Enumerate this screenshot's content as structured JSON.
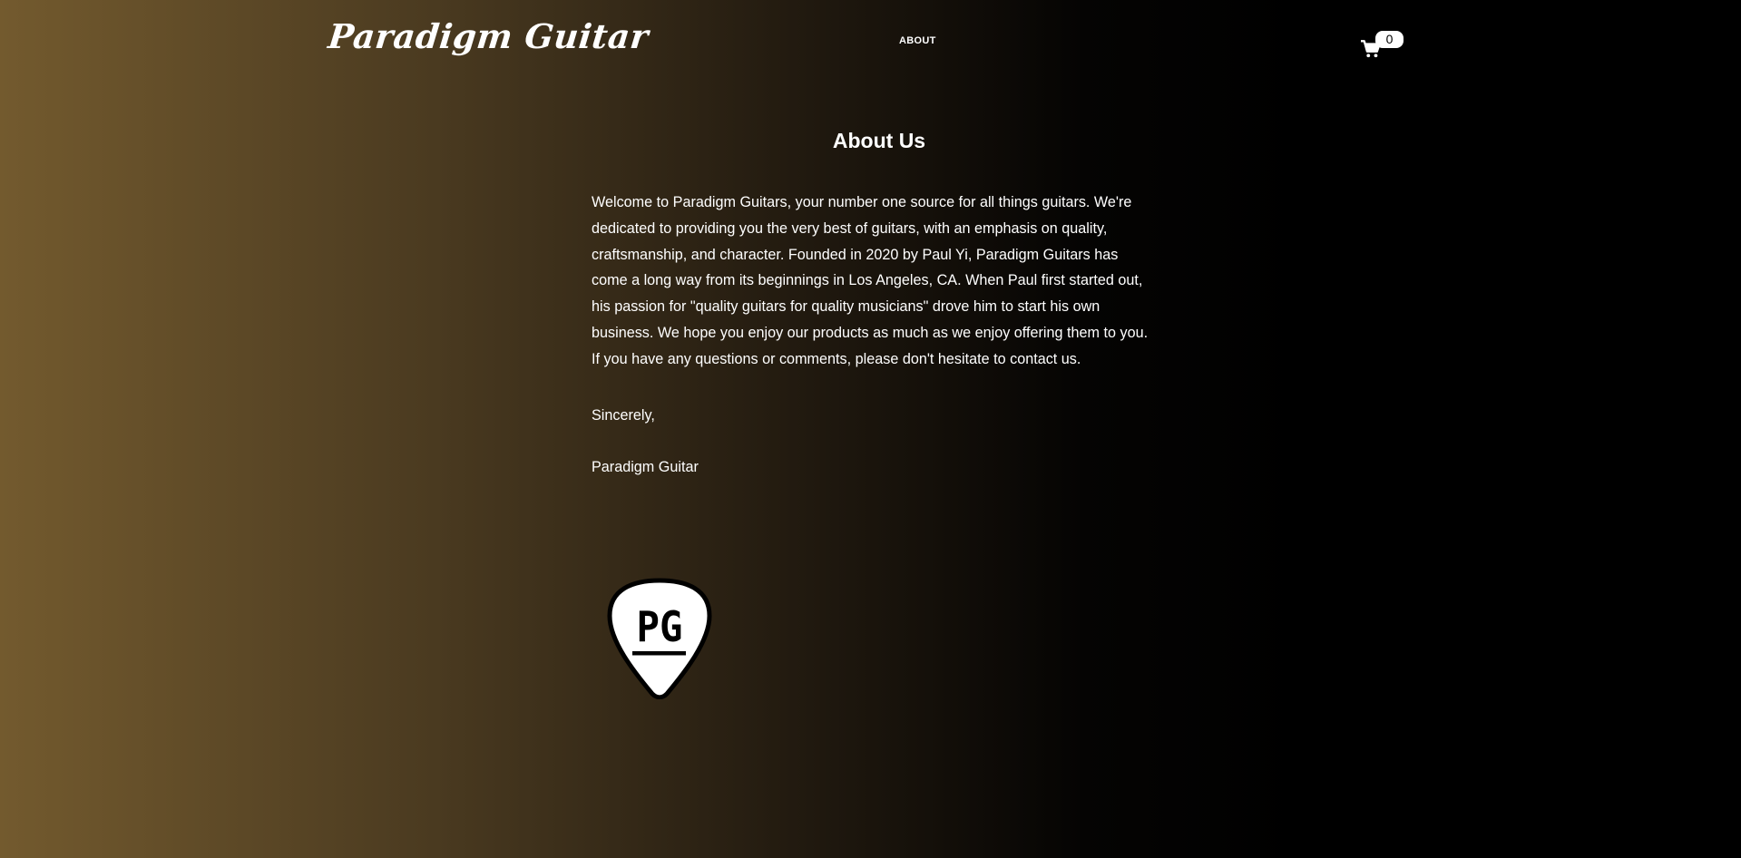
{
  "header": {
    "logo_text": "Paradigm Guitar",
    "nav": {
      "about_label": "ABOUT"
    },
    "cart": {
      "icon": "shopping-cart-icon",
      "count": "0"
    }
  },
  "main": {
    "title": "About Us",
    "intro": "Welcome to Paradigm Guitars, your number one source for all things guitars. We're dedicated to providing you the very best of guitars, with an emphasis on quality, craftsmanship, and character. Founded in 2020 by Paul Yi, Paradigm Guitars has come a long way from its beginnings in Los Angeles, CA. When Paul first started out, his passion for \"quality guitars for quality musicians\" drove him to start his own business. We hope you enjoy our products as much as we enjoy offering them to you. If you have any questions or comments, please don't hesitate to contact us.",
    "closing": "Sincerely,",
    "signature": "Paradigm Guitar",
    "pick_logo_text": "PG"
  },
  "colors": {
    "gradient_left": "#735a2e",
    "gradient_right": "#000000",
    "text": "#ffffff"
  }
}
